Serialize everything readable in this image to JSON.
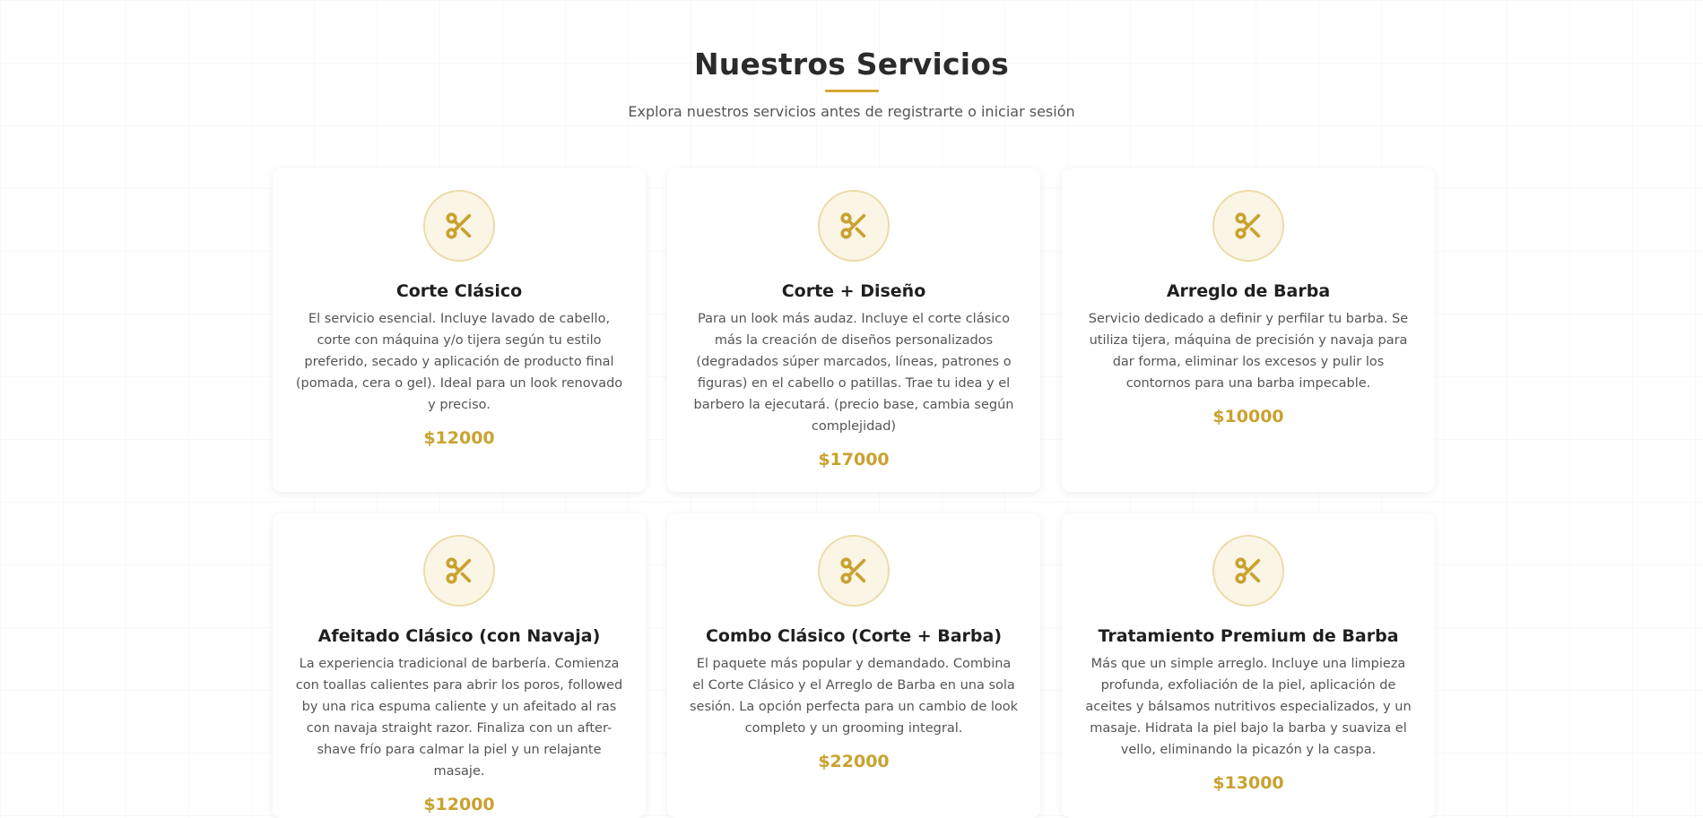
{
  "header": {
    "title": "Nuestros Servicios",
    "subtitle": "Explora nuestros servicios antes de registrarte o iniciar sesión"
  },
  "colors": {
    "accent": "#d4a82e",
    "price": "#c9a230",
    "icon_bg": "#fbf5e6"
  },
  "services": [
    {
      "icon": "scissors-icon",
      "title": "Corte Clásico",
      "description": "El servicio esencial. Incluye lavado de cabello, corte con máquina y/o tijera según tu estilo preferido, secado y aplicación de producto final (pomada, cera o gel). Ideal para un look renovado y preciso.",
      "price": "$12000"
    },
    {
      "icon": "scissors-icon",
      "title": "Corte + Diseño",
      "description": "Para un look más audaz. Incluye el corte clásico más la creación de diseños personalizados (degradados súper marcados, líneas, patrones o figuras) en el cabello o patillas. Trae tu idea y el barbero la ejecutará. (precio base, cambia según complejidad)",
      "price": "$17000"
    },
    {
      "icon": "scissors-icon",
      "title": "Arreglo de Barba",
      "description": "Servicio dedicado a definir y perfilar tu barba. Se utiliza tijera, máquina de precisión y navaja para dar forma, eliminar los excesos y pulir los contornos para una barba impecable.",
      "price": "$10000"
    },
    {
      "icon": "scissors-icon",
      "title": "Afeitado Clásico (con Navaja)",
      "description": "La experiencia tradicional de barbería. Comienza con toallas calientes para abrir los poros, followed by una rica espuma caliente y un afeitado al ras con navaja straight razor. Finaliza con un after-shave frío para calmar la piel y un relajante masaje.",
      "price": "$12000"
    },
    {
      "icon": "scissors-icon",
      "title": "Combo Clásico (Corte + Barba)",
      "description": "El paquete más popular y demandado. Combina el Corte Clásico y el Arreglo de Barba en una sola sesión. La opción perfecta para un cambio de look completo y un grooming integral.",
      "price": "$22000"
    },
    {
      "icon": "scissors-icon",
      "title": "Tratamiento Premium de Barba",
      "description": "Más que un simple arreglo. Incluye una limpieza profunda, exfoliación de la piel, aplicación de aceites y bálsamos nutritivos especializados, y un masaje. Hidrata la piel bajo la barba y suaviza el vello, eliminando la picazón y la caspa.",
      "price": "$13000"
    }
  ]
}
